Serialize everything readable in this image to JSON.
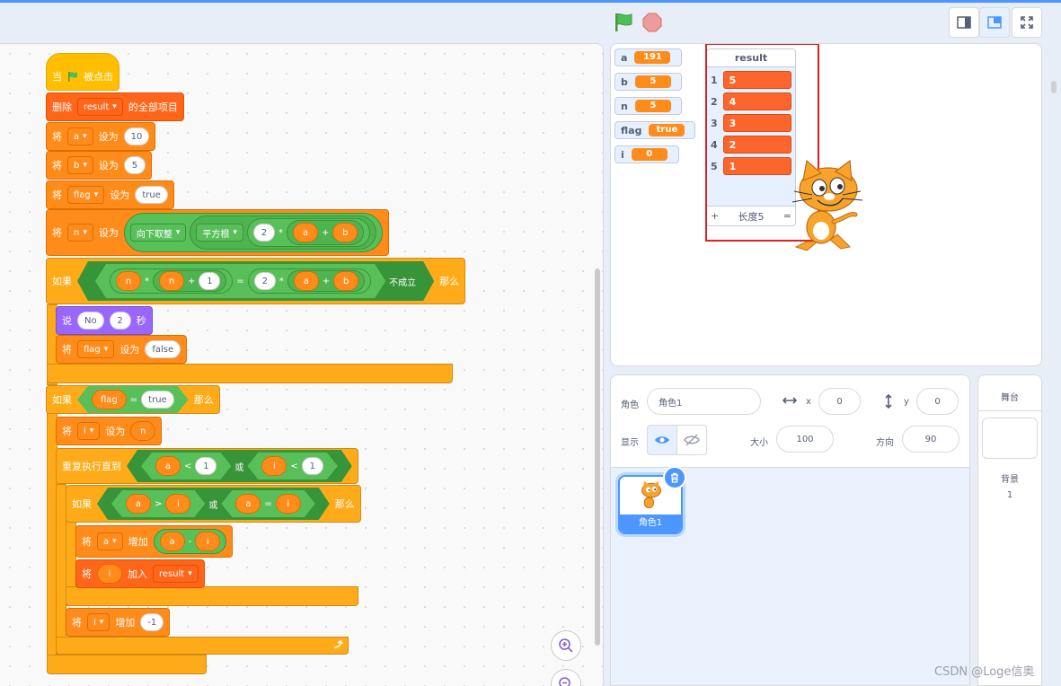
{
  "controls": {
    "green_flag": "green-flag-icon",
    "stop": "stop-icon"
  },
  "colors": {
    "accent": "#4c97ff",
    "event": "#ffbf00",
    "control": "#ffab19",
    "variable": "#ff8c1a",
    "list": "#ff661a",
    "operator": "#59c059",
    "looks": "#9966ff"
  },
  "script": {
    "hat": {
      "when": "当",
      "clicked": "被点击"
    },
    "delete": {
      "label": "删除",
      "list": "result",
      "suffix": "的全部项目"
    },
    "set_a": {
      "label": "将",
      "var": "a",
      "to": "设为",
      "value": "10"
    },
    "set_b": {
      "label": "将",
      "var": "b",
      "to": "设为",
      "value": "5"
    },
    "set_flag": {
      "label": "将",
      "var": "flag",
      "to": "设为",
      "value": "true"
    },
    "set_n": {
      "label": "将",
      "var": "n",
      "to": "设为",
      "floor": "向下取整",
      "sqrt": "平方根",
      "two": "2",
      "times": "*",
      "a": "a",
      "plus": "+",
      "b": "b"
    },
    "if1": {
      "label": "如果",
      "n1": "n",
      "times": "*",
      "n2": "n",
      "plus": "+",
      "one": "1",
      "eq": "=",
      "two": "2",
      "times2": "*",
      "a": "a",
      "plus2": "+",
      "b": "b",
      "not": "不成立",
      "then": "那么"
    },
    "say": {
      "label": "说",
      "msg": "No",
      "secs": "2",
      "unit": "秒"
    },
    "set_flag2": {
      "label": "将",
      "var": "flag",
      "to": "设为",
      "value": "false"
    },
    "if2": {
      "label": "如果",
      "flag": "flag",
      "eq": "=",
      "value": "true",
      "then": "那么"
    },
    "set_i": {
      "label": "将",
      "var": "i",
      "to": "设为",
      "value": "n"
    },
    "repeat": {
      "label": "重复执行直到",
      "a": "a",
      "lt": "<",
      "one": "1",
      "or": "或",
      "i": "i",
      "lt2": "<",
      "one2": "1"
    },
    "if3": {
      "label": "如果",
      "a": "a",
      "gt": ">",
      "i": "i",
      "or": "或",
      "a2": "a",
      "eq": "=",
      "i2": "i",
      "then": "那么"
    },
    "change_a": {
      "label": "将",
      "var": "a",
      "by": "增加",
      "a": "a",
      "minus": "-",
      "i": "i"
    },
    "add_i": {
      "label": "将",
      "i": "i",
      "add": "加入",
      "list": "result"
    },
    "change_i": {
      "label": "将",
      "var": "i",
      "by": "增加",
      "value": "-1"
    }
  },
  "monitors": [
    {
      "name": "a",
      "value": "191"
    },
    {
      "name": "b",
      "value": "5"
    },
    {
      "name": "n",
      "value": "5"
    },
    {
      "name": "flag",
      "value": "true"
    },
    {
      "name": "i",
      "value": "0"
    }
  ],
  "list_monitor": {
    "title": "result",
    "items": [
      {
        "index": "1",
        "value": "5"
      },
      {
        "index": "2",
        "value": "4"
      },
      {
        "index": "3",
        "value": "3"
      },
      {
        "index": "4",
        "value": "2"
      },
      {
        "index": "5",
        "value": "1"
      }
    ],
    "add": "+",
    "length": "长度5",
    "resize": "="
  },
  "sprite_info": {
    "sprite_label": "角色",
    "sprite_name": "角色1",
    "x_label": "x",
    "x_value": "0",
    "y_label": "y",
    "y_value": "0",
    "show_label": "显示",
    "size_label": "大小",
    "size_value": "100",
    "direction_label": "方向",
    "direction_value": "90"
  },
  "sprites": [
    {
      "name": "角色1"
    }
  ],
  "stage_pane": {
    "title": "舞台",
    "backdrops_label": "背景",
    "backdrops_count": "1"
  },
  "watermark": "CSDN @Loge信奥"
}
